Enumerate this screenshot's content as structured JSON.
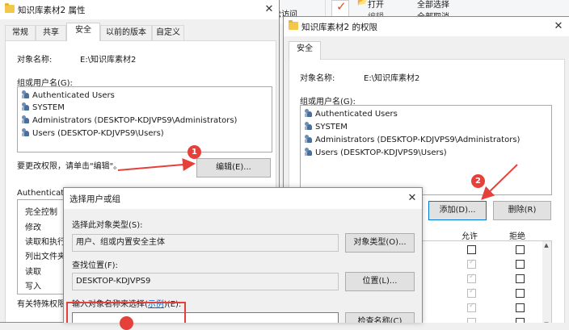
{
  "ribbon": {
    "easy_access": "松访问",
    "open": "打开",
    "edit": "编辑",
    "select_all": "全部选择",
    "deselect_all": "全部取消"
  },
  "prop_window": {
    "title": "知识库素材2 属性",
    "tabs": [
      "常规",
      "共享",
      "安全",
      "以前的版本",
      "自定义"
    ],
    "object_name_label": "对象名称:",
    "object_name_value": "E:\\知识库素材2",
    "group_label": "组或用户名(G):",
    "users": [
      "Authenticated Users",
      "SYSTEM",
      "Administrators (DESKTOP-KDJVPS9\\Administrators)",
      "Users (DESKTOP-KDJVPS9\\Users)"
    ],
    "change_hint": "要更改权限，请单击\"编辑\"。",
    "edit_button": "编辑(E)...",
    "perm_group_label": "Authenticat",
    "permissions": [
      "完全控制",
      "修改",
      "读取和执行",
      "列出文件夹",
      "读取",
      "写入"
    ],
    "special_note": "有关特殊权限"
  },
  "perm_window": {
    "title": "知识库素材2 的权限",
    "tab": "安全",
    "object_name_label": "对象名称:",
    "object_name_value": "E:\\知识库素材2",
    "group_label": "组或用户名(G):",
    "users": [
      "Authenticated Users",
      "SYSTEM",
      "Administrators (DESKTOP-KDJVPS9\\Administrators)",
      "Users (DESKTOP-KDJVPS9\\Users)"
    ],
    "add_button": "添加(D)...",
    "remove_button": "删除(R)",
    "allow_col": "允许",
    "deny_col": "拒绝"
  },
  "select_dialog": {
    "title": "选择用户或组",
    "object_type_label": "选择此对象类型(S):",
    "object_type_value": "用户、组或内置安全主体",
    "object_type_button": "对象类型(O)...",
    "location_label": "查找位置(F):",
    "location_value": "DESKTOP-KDJVPS9",
    "location_button": "位置(L)...",
    "names_label_prefix": "输入对象名称来选择(",
    "names_label_link": "示例",
    "names_label_suffix": ")(E):",
    "check_names_button": "检查名称(C)"
  },
  "annotations": {
    "badge1": "1",
    "badge2": "2",
    "color_red": "#e5413a"
  }
}
